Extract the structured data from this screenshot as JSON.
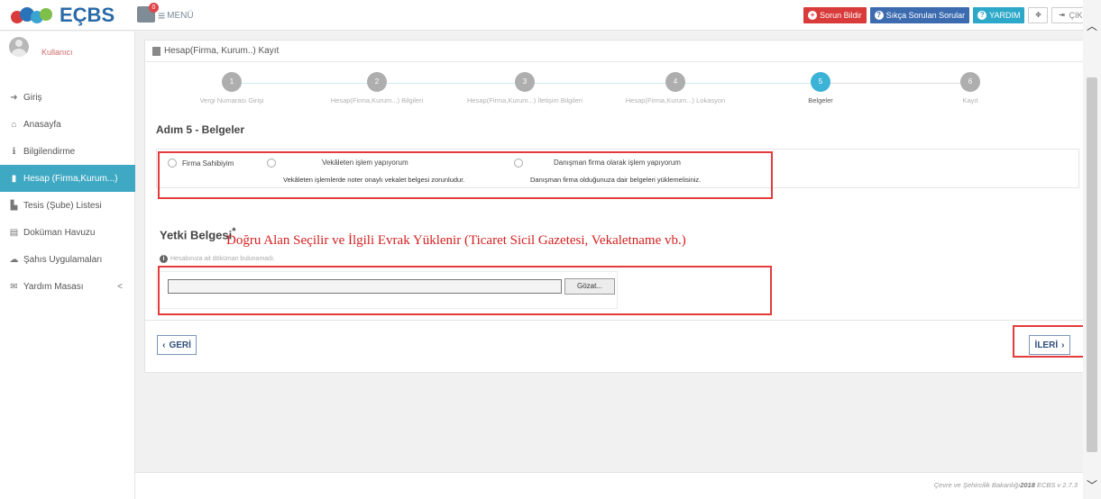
{
  "topbar": {
    "logo_text": "EÇBS",
    "notif_count": "0",
    "menu_label": "MENÜ",
    "buttons": [
      {
        "label": "Sorun Bildir",
        "icon": "plus-circle-icon"
      },
      {
        "label": "Sıkça Sorulan Sorular",
        "icon": "question-icon"
      },
      {
        "label": "YARDIM",
        "icon": "question-icon"
      },
      {
        "label": "",
        "icon": "move-icon"
      },
      {
        "label": "ÇIKIŞ",
        "icon": "logout-icon"
      }
    ]
  },
  "sidebar": {
    "user_name": "Kullanıcı",
    "items": [
      {
        "label": "Giriş",
        "icon": "login-icon"
      },
      {
        "label": "Anasayfa",
        "icon": "home-icon"
      },
      {
        "label": "Bilgilendirme",
        "icon": "info-icon"
      },
      {
        "label": "Hesap (Firma,Kurum...)",
        "icon": "building-icon",
        "active": true
      },
      {
        "label": "Tesis (Şube) Listesi",
        "icon": "factory-icon"
      },
      {
        "label": "Doküman Havuzu",
        "icon": "documents-icon"
      },
      {
        "label": "Şahıs Uygulamaları",
        "icon": "cloud-icon"
      },
      {
        "label": "Yardım Masası",
        "icon": "envelope-icon",
        "chevron": "<"
      }
    ]
  },
  "panel": {
    "title": "Hesap(Firma, Kurum..) Kayıt",
    "steps": [
      {
        "num": "1",
        "label": "Vergi Numarası Girişi"
      },
      {
        "num": "2",
        "label": "Hesap(Firma,Kurum...) Bilgileri"
      },
      {
        "num": "3",
        "label": "Hesap(Firma,Kurum...) İletişim Bilgileri"
      },
      {
        "num": "4",
        "label": "Hesap(Firma,Kurum...) Lokasyon"
      },
      {
        "num": "5",
        "label": "Belgeler",
        "active": true
      },
      {
        "num": "6",
        "label": "Kayıt"
      }
    ],
    "step_title": "Adım 5 - Belgeler",
    "options": [
      {
        "label": "Firma Sahibiyim",
        "hint": ""
      },
      {
        "label": "Vekâleten işlem yapıyorum",
        "hint": "Vekâleten işlemlerde noter onaylı vekalet belgesi zorunludur."
      },
      {
        "label": "Danışman firma olarak işlem yapıyorum",
        "hint": "Danışman firma olduğunuza dair belgeleri yüklemelisiniz."
      }
    ],
    "yetki_label": "Yetki Belgesi",
    "required_mark": "*",
    "annotation": "Doğru Alan Seçilir ve İlgili Evrak Yüklenir (Ticaret Sicil Gazetesi, Vekaletname vb.)",
    "info_text": "Hesabınıza ait döküman bulunamadı.",
    "browse_label": "Gözat...",
    "back_label": "GERİ",
    "next_label": "İLERİ"
  },
  "footer": {
    "org": "Çevre ve Şehircilik Bakanlığı",
    "year": "2018",
    "version": "ECBS v 2.7.3"
  },
  "colors": {
    "accent": "#3bb3d6",
    "highlight": "#e43c3c",
    "annotation": "#d42020"
  }
}
